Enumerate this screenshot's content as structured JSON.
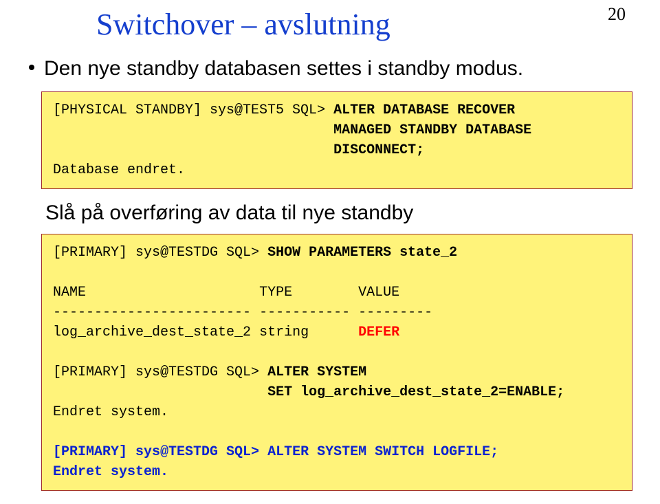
{
  "page_number": "20",
  "title": "Switchover – avslutning",
  "bullet1": "Den nye standby databasen settes i standby modus.",
  "code1": {
    "prompt1": "[PHYSICAL STANDBY] sys@TEST5 SQL> ",
    "cmd1_p1": "ALTER DATABASE RECOVER",
    "cmd1_p2": "MANAGED STANDBY DATABASE",
    "cmd1_p3": "DISCONNECT;",
    "resp1": "Database endret."
  },
  "subtext": "Slå på overføring av data til nye standby",
  "code2": {
    "prompt1": "[PRIMARY] sys@TESTDG SQL> ",
    "cmd1": "SHOW PARAMETERS state_2",
    "hdr_name": "NAME",
    "hdr_type": "TYPE",
    "hdr_value": "VALUE",
    "sep1": "------------------------",
    "sep2": "-----------",
    "sep3": "---------",
    "row_name": "log_archive_dest_state_2",
    "row_type": "string",
    "row_value": "DEFER",
    "prompt2": "[PRIMARY] sys@TESTDG SQL> ",
    "cmd2_p1": "ALTER SYSTEM",
    "cmd2_p2": "SET log_archive_dest_state_2=ENABLE;",
    "resp2": "Endret system.",
    "prompt3": "[PRIMARY] sys@TESTDG SQL> ",
    "cmd3": "ALTER SYSTEM SWITCH LOGFILE;",
    "resp3": "Endret system."
  }
}
